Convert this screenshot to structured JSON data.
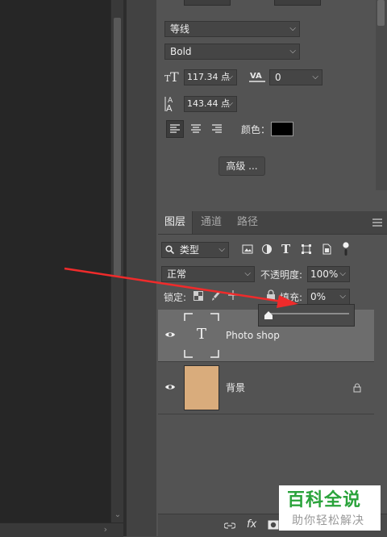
{
  "character": {
    "font_family": "等线",
    "font_style": "Bold",
    "font_size": "117.34 点",
    "tracking": "0",
    "leading": "143.44 点",
    "color_label": "颜色：",
    "color_value": "#000000",
    "advanced_button": "高级 ..."
  },
  "layers_panel": {
    "tabs": [
      "图层",
      "通道",
      "路径"
    ],
    "filter_label": "类型",
    "blend_mode": "正常",
    "opacity_label": "不透明度:",
    "opacity_value": "100%",
    "lock_label": "锁定:",
    "fill_label": "填充:",
    "fill_value": "0%",
    "fill_slider_fraction": 0.0,
    "layers": [
      {
        "name": "Photo shop",
        "type": "text",
        "thumb_glyph": "T",
        "selected": true
      },
      {
        "name": "背景",
        "type": "raster",
        "thumb_color": "#d9ac7c",
        "locked": true
      }
    ],
    "bottom_fx": "fx"
  },
  "watermark": {
    "title": "百科全说",
    "subtitle": "助你轻松解决"
  },
  "annotation": {
    "arrow_color": "#ef2b2b"
  }
}
